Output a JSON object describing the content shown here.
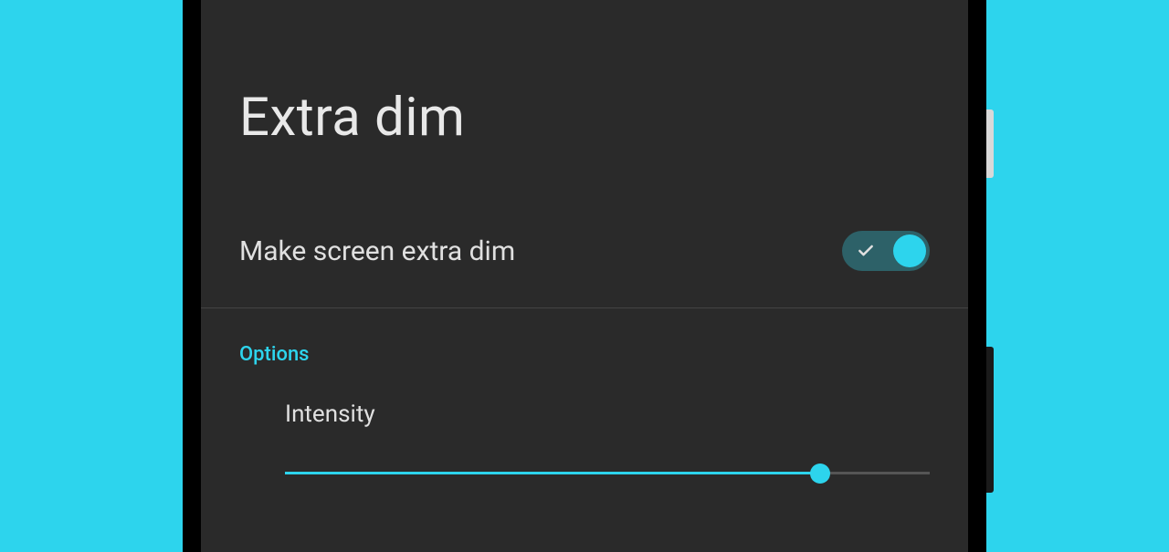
{
  "page": {
    "title": "Extra dim"
  },
  "toggle": {
    "label": "Make screen extra dim",
    "enabled": true
  },
  "options": {
    "header": "Options",
    "intensity": {
      "label": "Intensity",
      "value": 83
    }
  },
  "colors": {
    "accent": "#2dd4ed",
    "background": "#2a2a2a",
    "text_primary": "#e0e0e0",
    "toggle_track": "#2d6168"
  }
}
